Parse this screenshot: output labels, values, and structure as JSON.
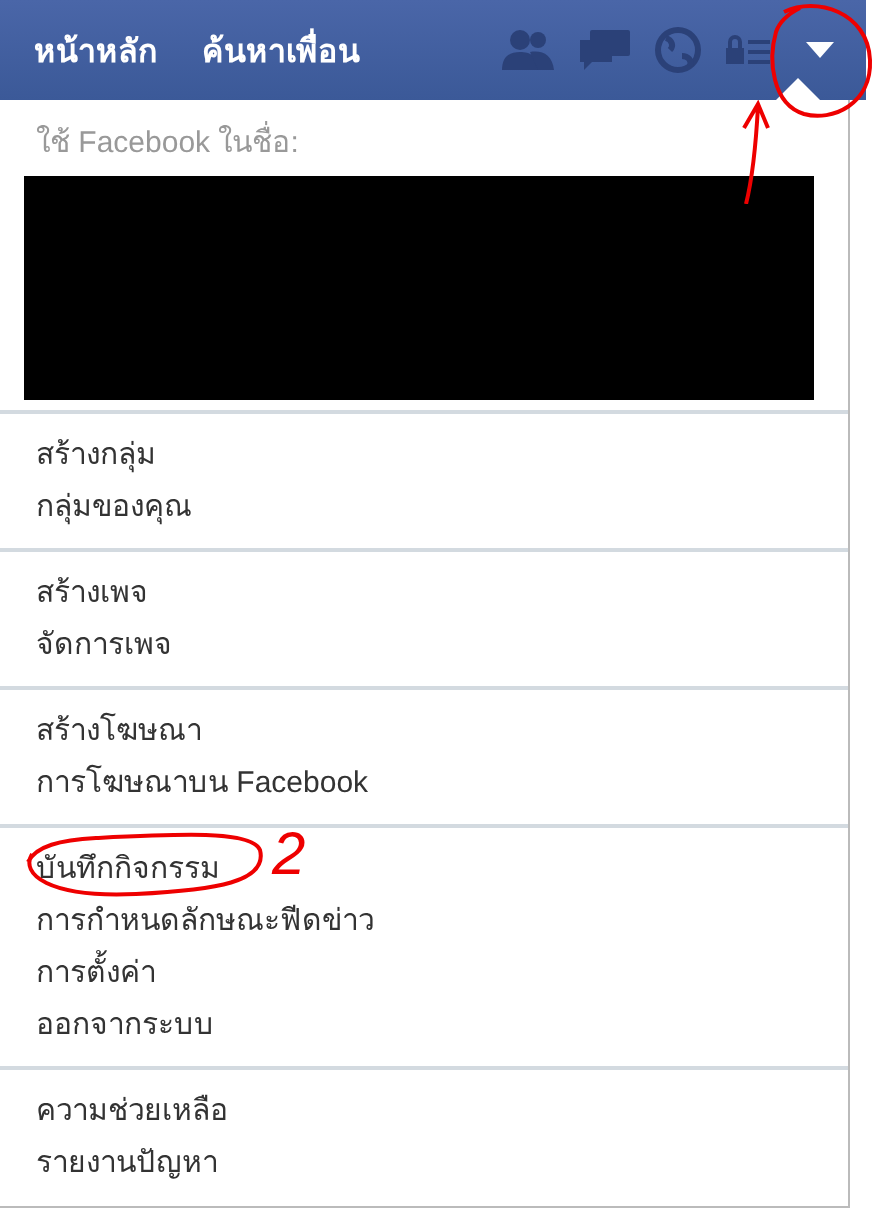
{
  "top_bar": {
    "links": [
      {
        "label": "หน้าหลัก"
      },
      {
        "label": "ค้นหาเพื่อน"
      }
    ]
  },
  "account_menu": {
    "heading": "ใช้ Facebook ในชื่อ:",
    "groups": [
      {
        "items": [
          {
            "label": "สร้างกลุ่ม"
          },
          {
            "label": "กลุ่มของคุณ"
          }
        ]
      },
      {
        "items": [
          {
            "label": "สร้างเพจ"
          },
          {
            "label": "จัดการเพจ"
          }
        ]
      },
      {
        "items": [
          {
            "label": "สร้างโฆษณา"
          },
          {
            "label": "การโฆษณาบน Facebook"
          }
        ]
      },
      {
        "items": [
          {
            "label": "บันทึกกิจกรรม"
          },
          {
            "label": "การกำหนดลักษณะฟีดข่าว"
          },
          {
            "label": "การตั้งค่า"
          },
          {
            "label": "ออกจากระบบ"
          }
        ]
      },
      {
        "items": [
          {
            "label": "ความช่วยเหลือ"
          },
          {
            "label": "รายงานปัญหา"
          }
        ]
      }
    ]
  },
  "annotation": {
    "step_label": "2"
  }
}
